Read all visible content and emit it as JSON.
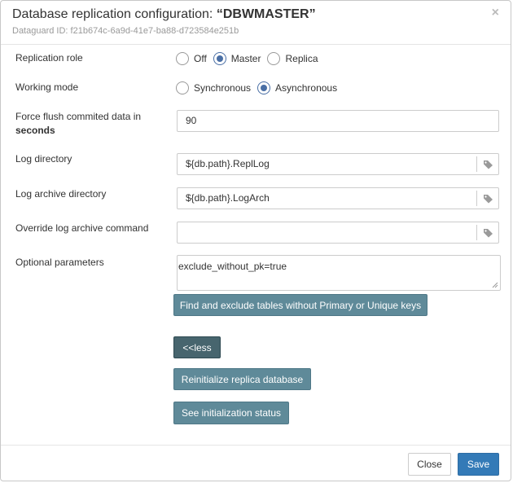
{
  "header": {
    "title_prefix": "Database replication configuration: ",
    "title_name": "“DBWMASTER”",
    "subtitle": "Dataguard ID: f21b674c-6a9d-41e7-ba88-d723584e251b",
    "close_icon": "×"
  },
  "form": {
    "replication_role": {
      "label": "Replication role",
      "options": [
        "Off",
        "Master",
        "Replica"
      ],
      "selected": "Master"
    },
    "working_mode": {
      "label": "Working mode",
      "options": [
        "Synchronous",
        "Asynchronous"
      ],
      "selected": "Asynchronous"
    },
    "force_flush": {
      "label_line1": "Force flush commited data in",
      "label_line2": "seconds",
      "value": "90"
    },
    "log_directory": {
      "label": "Log directory",
      "value": "${db.path}.ReplLog"
    },
    "log_archive_directory": {
      "label": "Log archive directory",
      "value": "${db.path}.LogArch"
    },
    "override_log_archive": {
      "label": "Override log archive command",
      "value": ""
    },
    "optional_parameters": {
      "label": "Optional parameters",
      "value": "exclude_without_pk=true"
    }
  },
  "buttons": {
    "find_exclude": "Find and exclude tables without Primary or Unique keys",
    "less": "<<less",
    "reinitialize": "Reinitialize replica database",
    "see_status": "See initialization status",
    "close": "Close",
    "save": "Save"
  },
  "colors": {
    "accent": "#337ab7",
    "secondary_button": "#5f8a99",
    "radio_checked": "#4a6fa5"
  },
  "icons": {
    "tag": "tag-icon",
    "close": "close-icon"
  }
}
